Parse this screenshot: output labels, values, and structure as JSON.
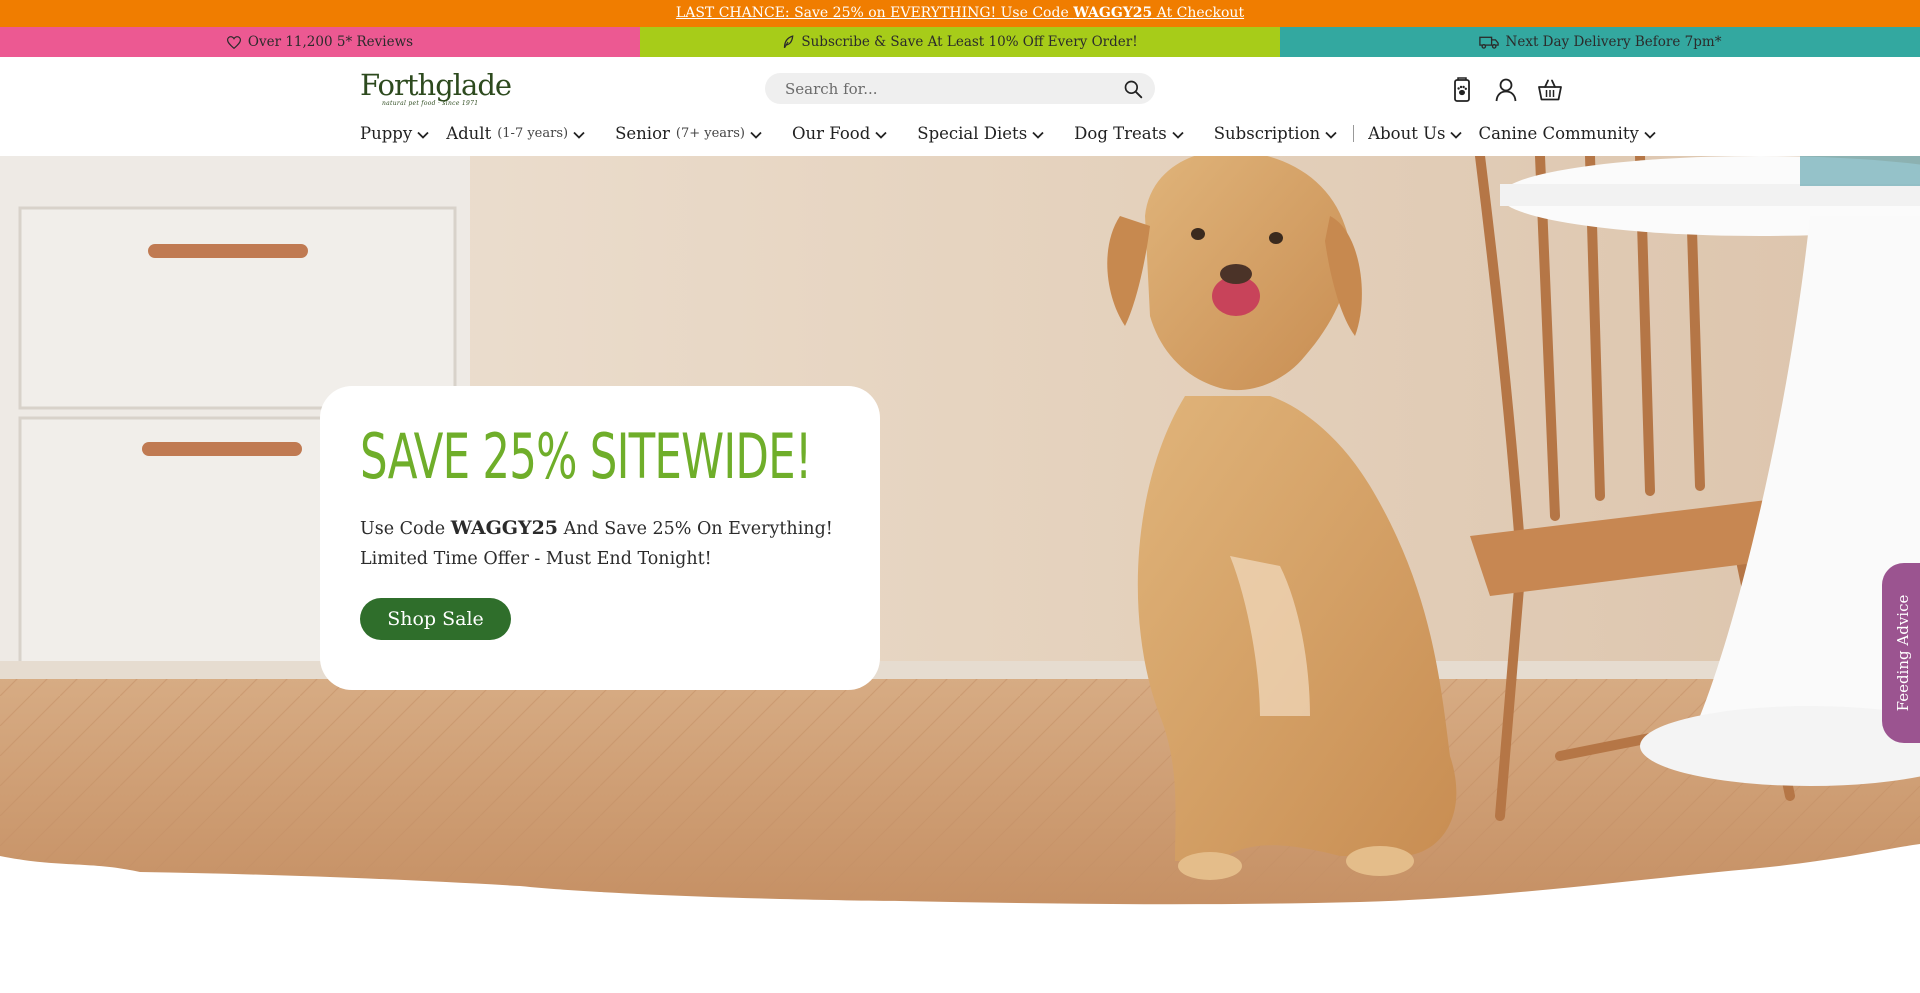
{
  "announcement": {
    "prefix": "LAST CHANCE: Save 25% on EVERYTHING!",
    "middle": " Use Code ",
    "code": "WAGGY25",
    "suffix": " At Checkout"
  },
  "usp_bar": [
    {
      "text": "Over 11,200 5* Reviews",
      "icon": "heart-icon",
      "color": "#ec5992"
    },
    {
      "text": "Subscribe & Save At Least 10% Off Every Order!",
      "icon": "leaf-icon",
      "color": "#a7cc19"
    },
    {
      "text": "Next Day Delivery Before 7pm*",
      "icon": "truck-icon",
      "color": "#33a8a0"
    }
  ],
  "header": {
    "logo_text": "Forthglade",
    "logo_tagline": "natural pet food · since 1971",
    "search_placeholder": "Search for...",
    "icons": [
      "paw-bag-icon",
      "account-icon",
      "basket-icon"
    ]
  },
  "nav": [
    {
      "label": "Puppy",
      "sub": ""
    },
    {
      "label": "Adult",
      "sub": "(1-7 years)"
    },
    {
      "label": "Senior",
      "sub": "(7+ years)"
    },
    {
      "label": "Our Food",
      "sub": ""
    },
    {
      "label": "Special Diets",
      "sub": ""
    },
    {
      "label": "Dog Treats",
      "sub": ""
    },
    {
      "label": "Subscription",
      "sub": ""
    },
    {
      "label": "About Us",
      "sub": ""
    },
    {
      "label": "Canine Community",
      "sub": ""
    }
  ],
  "hero": {
    "title": "SAVE 25% SITEWIDE!",
    "line1_pre": "Use Code ",
    "line1_code": "WAGGY25",
    "line1_post": " And Save 25% On Everything!",
    "line2": "Limited Time Offer - Must End Tonight!",
    "cta": "Shop Sale"
  },
  "side_tab": "Feeding Advice",
  "colors": {
    "announcement": "#f07d00",
    "brand_green": "#2f6e2b",
    "title_green": "#6fae2a",
    "side_tab": "#9b5490"
  }
}
